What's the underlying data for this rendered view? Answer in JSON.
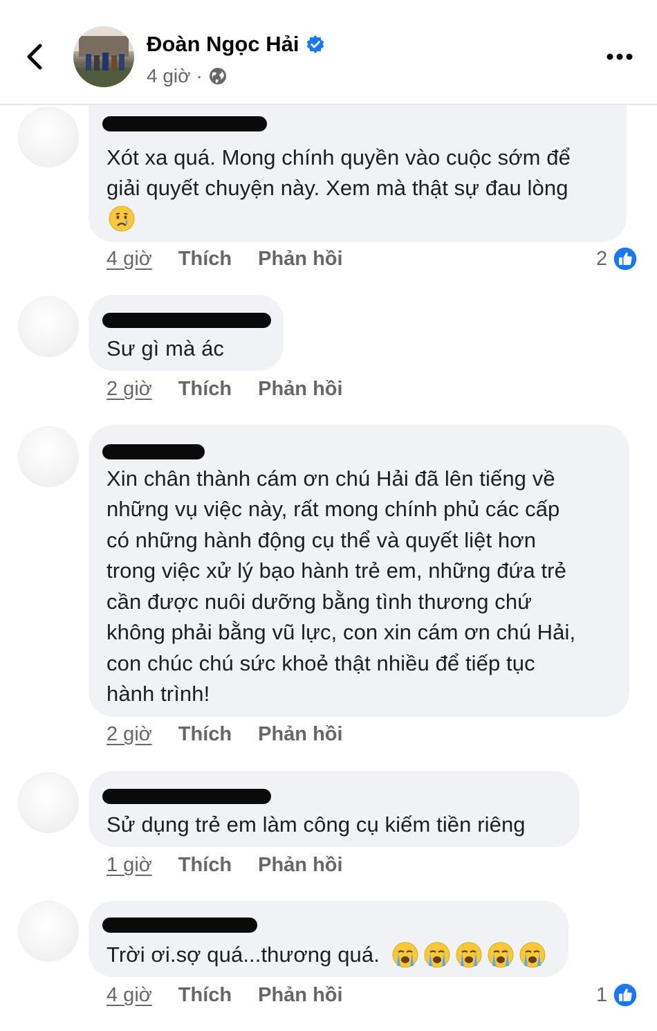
{
  "header": {
    "name": "Đoàn Ngọc Hải",
    "time": "4 giờ",
    "separator": "·",
    "verified_color": "#1877f2"
  },
  "comments": [
    {
      "lines": [
        "Xót xa quá. Mong chính quyền vào cuộc sớm để",
        "giải quyết chuyện này. Xem mà thật sự đau lòng"
      ],
      "emoji": [
        "crying-face"
      ],
      "time": "4 giờ",
      "like": "Thích",
      "reply": "Phản hồi",
      "reactions": "2"
    },
    {
      "lines": [
        "Sư gì mà ác"
      ],
      "time": "2 giờ",
      "like": "Thích",
      "reply": "Phản hồi"
    },
    {
      "lines": [
        "Xin chân thành cám ơn chú Hải đã lên tiếng về",
        "những vụ việc này, rất mong chính phủ các cấp",
        "có những hành động cụ thể và quyết liệt hơn",
        "trong việc xử lý bạo hành trẻ em, những đứa trẻ",
        "cần được nuôi dưỡng bằng tình thương chứ",
        "không phải bằng vũ lực, con xin cám ơn chú Hải,",
        "con chúc chú sức khoẻ thật nhiều để tiếp tục",
        "hành trình!"
      ],
      "time": "2 giờ",
      "like": "Thích",
      "reply": "Phản hồi"
    },
    {
      "lines": [
        "Sử dụng trẻ em làm công cụ kiếm tiền riêng"
      ],
      "time": "1 giờ",
      "like": "Thích",
      "reply": "Phản hồi"
    },
    {
      "lines": [
        "Trời ơi.sợ quá...thương quá."
      ],
      "emoji": [
        "loudly-crying-face",
        "loudly-crying-face",
        "loudly-crying-face",
        "loudly-crying-face",
        "loudly-crying-face"
      ],
      "time": "4 giờ",
      "like": "Thích",
      "reply": "Phản hồi",
      "reactions": "1"
    }
  ],
  "colors": {
    "like_blue": "#1877f2",
    "bubble": "#f0f2f5",
    "muted": "#65676b"
  }
}
